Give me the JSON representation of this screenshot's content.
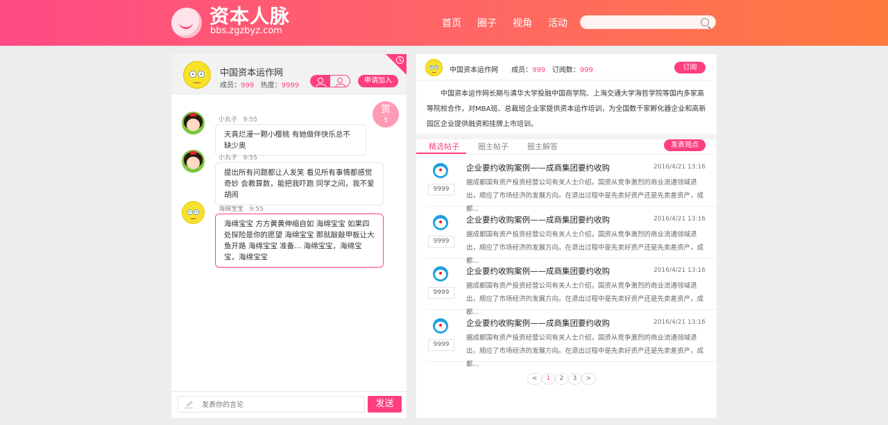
{
  "header": {
    "logo_title": "资本人脉",
    "logo_url": "bbs.zgzbyz.com",
    "nav": [
      "首页",
      "圈子",
      "视角",
      "活动"
    ],
    "search": {
      "value": "",
      "placeholder": ""
    }
  },
  "chat_panel": {
    "group_name": "中国资本运作网",
    "members_label": "成员：",
    "members_value": "999",
    "heat_label": "热度：",
    "heat_value": "9999",
    "join_label": "申请加入",
    "reward_label": "赏",
    "reward_count": "5",
    "messages": [
      {
        "author": "小丸子",
        "time": "9:55",
        "text": "天真烂漫一颗小樱桃 有她做伴快乐总不缺少奥"
      },
      {
        "author": "小丸子",
        "time": "9:55",
        "text": "提出所有问题都让人发笑  看见所有事情都感觉奇妙 会教算数，能把我吓跑  同学之间，我不爱胡闹"
      },
      {
        "author": "海绵宝宝",
        "time": "9:55",
        "text": "海绵宝宝   方方黄黄伸缩自如   海绵宝宝   如果四处探险是你的愿望   海绵宝宝   那就敲敲甲板让大鱼开路 海绵宝宝   准备... 海绵宝宝，海绵宝宝，海绵宝宝"
      }
    ],
    "composer_placeholder": "发表你的言论",
    "send_label": "发送"
  },
  "group_panel": {
    "name": "中国资本运作网",
    "members_label": "成员：",
    "members_value": "999",
    "subs_label": "订阅数：",
    "subs_value": "999",
    "subscribe_label": "订阅",
    "description": "中国资本运作网长期与清华大学投融中国商学院、上海交通大学海哲学院等国内多家高等院校合作，对MBA班、总裁班企业家提供资本运作培训，为全国数千家孵化器企业和高新园区企业提供融资和挂牌上市培训。",
    "tabs": [
      "精选帖子",
      "圈主帖子",
      "圈主解答"
    ],
    "post_button": "发表观点",
    "posts": [
      {
        "title": "企业要约收购案例——成商集团要约收购",
        "date": "2016/4/21  13:16",
        "count": "9999",
        "excerpt": "据成都国有资产投资经营公司有关人士介绍，国资从竞争激烈的商业流通领域退出，顺应了市场经济的发展方向。在退出过程中是先卖好资产还是先卖差资产，成都..."
      },
      {
        "title": "企业要约收购案例——成商集团要约收购",
        "date": "2016/4/21  13:16",
        "count": "9999",
        "excerpt": "据成都国有资产投资经营公司有关人士介绍，国资从竞争激烈的商业流通领域退出，顺应了市场经济的发展方向。在退出过程中是先卖好资产还是先卖差资产，成都..."
      },
      {
        "title": "企业要约收购案例——成商集团要约收购",
        "date": "2016/4/21  13:16",
        "count": "9999",
        "excerpt": "据成都国有资产投资经营公司有关人士介绍，国资从竞争激烈的商业流通领域退出，顺应了市场经济的发展方向。在退出过程中是先卖好资产还是先卖差资产，成都..."
      },
      {
        "title": "企业要约收购案例——成商集团要约收购",
        "date": "2016/4/21  13:16",
        "count": "9999",
        "excerpt": "据成都国有资产投资经营公司有关人士介绍，国资从竞争激烈的商业流通领域退出，顺应了市场经济的发展方向。在退出过程中是先卖好资产还是先卖差资产，成都..."
      }
    ],
    "pagination": [
      "<",
      "1",
      "2",
      "3",
      ">"
    ]
  },
  "colors": {
    "accent": "#ff3f7d",
    "header_start": "#ff4a85",
    "header_end": "#ff7a3e"
  },
  "icons": [
    "search-icon",
    "clock-icon",
    "pencil-icon",
    "members-icon",
    "user-icon"
  ]
}
